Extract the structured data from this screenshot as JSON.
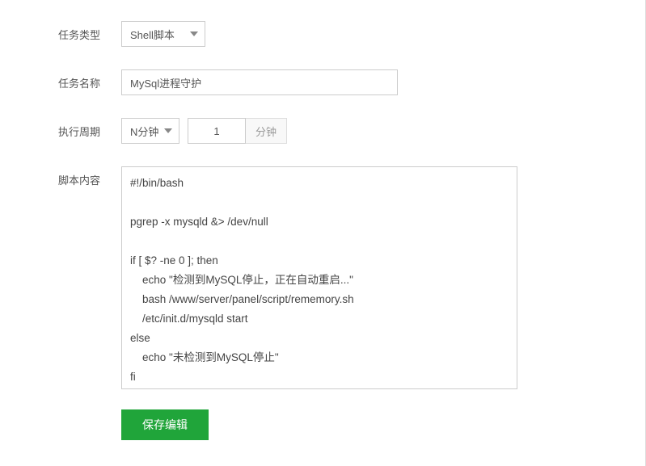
{
  "labels": {
    "task_type": "任务类型",
    "task_name": "任务名称",
    "interval": "执行周期",
    "script": "脚本内容"
  },
  "task_type": {
    "selected": "Shell脚本"
  },
  "task_name": {
    "value": "MySql进程守护"
  },
  "interval": {
    "unit_selected": "N分钟",
    "value": "1",
    "suffix": "分钟"
  },
  "script_content": "#!/bin/bash\n\npgrep -x mysqld &> /dev/null\n\nif [ $? -ne 0 ]; then\n    echo \"检测到MySQL停止，正在自动重启...\"\n    bash /www/server/panel/script/rememory.sh\n    /etc/init.d/mysqld start\nelse\n    echo \"未检测到MySQL停止\"\nfi",
  "actions": {
    "save": "保存编辑"
  }
}
